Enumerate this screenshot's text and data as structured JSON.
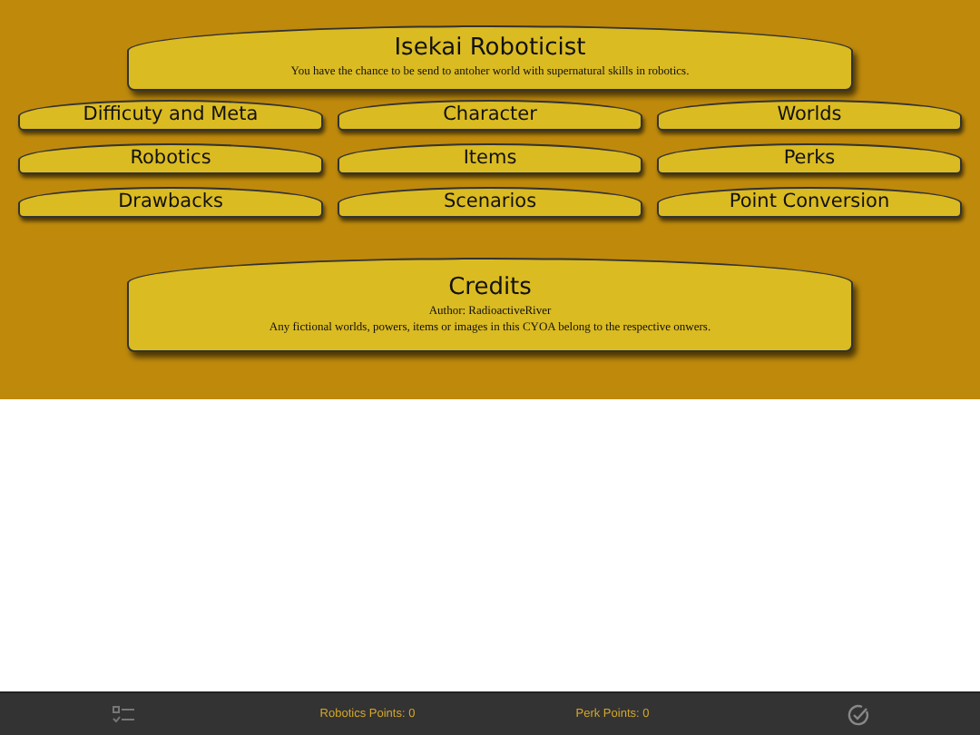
{
  "header": {
    "title": "Isekai Roboticist",
    "subtitle": "You have the chance to be send to antoher world with supernatural skills in robotics."
  },
  "sections": [
    "Difficuty and Meta",
    "Character",
    "Worlds",
    "Robotics",
    "Items",
    "Perks",
    "Drawbacks",
    "Scenarios",
    "Point Conversion"
  ],
  "credits": {
    "title": "Credits",
    "lines": [
      "Author: RadioactiveRiver",
      "Any fictional worlds, powers, items or images in this CYOA belong to the respective onwers."
    ]
  },
  "bottom_bar": {
    "points": [
      "Robotics Points: 0",
      "Perk Points: 0"
    ]
  }
}
